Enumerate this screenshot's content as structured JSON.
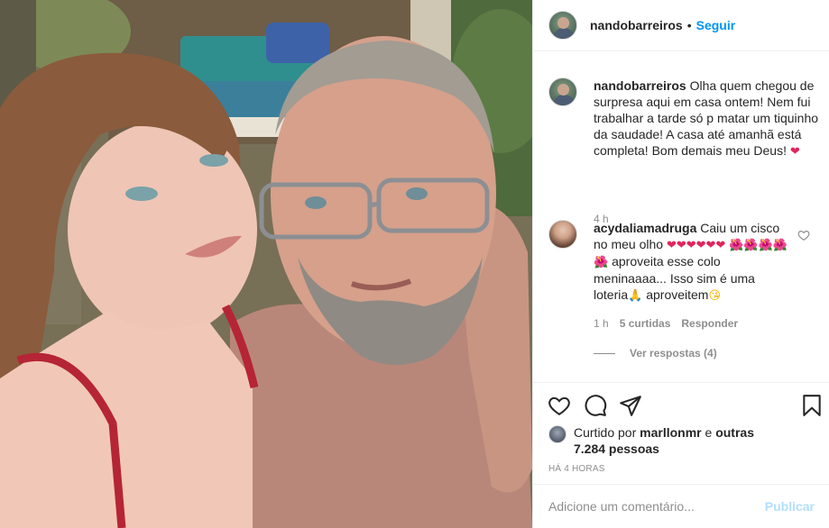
{
  "post": {
    "username": "nandobarreiros",
    "dot": "•",
    "follow_label": "Seguir"
  },
  "caption": {
    "username": "nandobarreiros",
    "text": "Olha quem chegou de surpresa aqui em casa ontem! Nem fui trabalhar a tarde só p matar um tiquinho da saudade! A casa até amanhã está completa! Bom demais meu Deus!",
    "emoji": "❤",
    "time": "4 h"
  },
  "comment": {
    "username": "acydaliamadruga",
    "text_1": "Caiu um cisco no meu olho",
    "hearts": "❤❤❤❤❤❤",
    "flowers": "🌺🌺🌺🌺🌺",
    "text_2": "aproveita esse colo meninaaaa... Isso sim é uma loteria",
    "pray": "🙏",
    "text_3": "aproveitem",
    "kiss": "😘",
    "time": "1 h",
    "likes": "5 curtidas",
    "reply_label": "Responder",
    "view_replies": "Ver respostas (4)"
  },
  "actions": {
    "icons": [
      "heart-icon",
      "comment-icon",
      "share-icon",
      "bookmark-icon"
    ]
  },
  "likes": {
    "prefix": "Curtido por",
    "user": "marllonmr",
    "suffix": "e",
    "others": "outras 7.284 pessoas"
  },
  "timestamp": "HÁ 4 HORAS",
  "add_comment": {
    "placeholder": "Adicione um comentário...",
    "publish_label": "Publicar"
  },
  "colors": {
    "link_blue": "#0095f6",
    "publish_disabled": "#b2dffc",
    "secondary_text": "#8e8e8e",
    "heart_red": "#ed4956"
  }
}
